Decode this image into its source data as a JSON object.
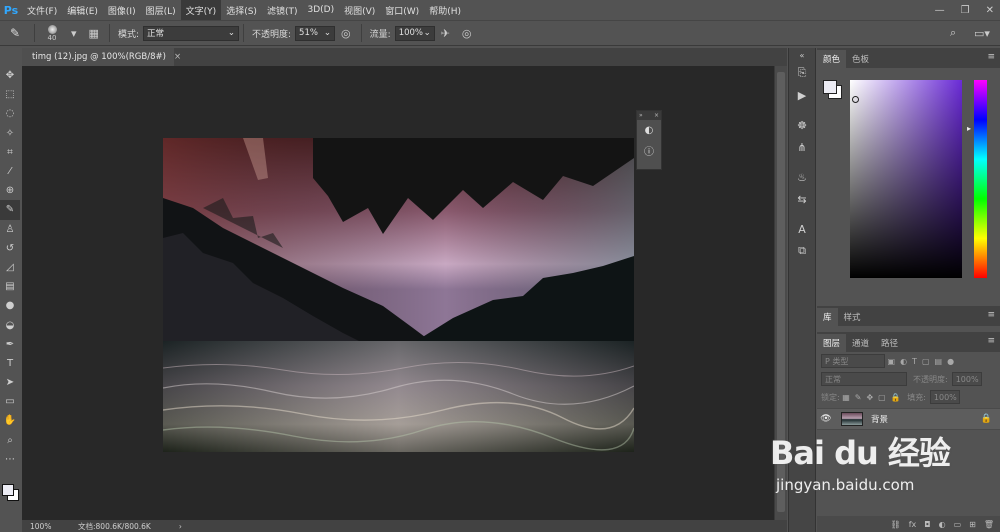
{
  "app": {
    "logo": "Ps"
  },
  "menu": [
    "文件(F)",
    "编辑(E)",
    "图像(I)",
    "图层(L)",
    "文字(Y)",
    "选择(S)",
    "滤镜(T)",
    "3D(D)",
    "视图(V)",
    "窗口(W)",
    "帮助(H)"
  ],
  "window_controls": [
    "—",
    "❐",
    "✕"
  ],
  "options": {
    "brush_size": "40",
    "mode_label": "模式:",
    "mode_value": "正常",
    "opacity_label": "不透明度:",
    "opacity_value": "51%",
    "flow_label": "流量:",
    "flow_value": "100%"
  },
  "document": {
    "tab_title": "timg (12).jpg @ 100%(RGB/8#)",
    "tab_close": "×",
    "zoom": "100%",
    "doc_info": "文档:800.6K/800.6K",
    "status_arrow": "›"
  },
  "panels": {
    "color_tabs": [
      "颜色",
      "色板"
    ],
    "library_tabs": [
      "库",
      "样式"
    ],
    "layer_tabs": [
      "图层",
      "通道",
      "路径"
    ],
    "layer_filter": "P 类型",
    "blend_mode": "正常",
    "opacity_label": "不透明度:",
    "opacity_value": "100%",
    "lock_label": "锁定:",
    "fill_label": "填充:",
    "fill_value": "100%",
    "layer_name": "背景",
    "menu_icon": "≡"
  },
  "colors": {
    "foreground": "#ececf4",
    "background": "#ffffff",
    "hue_selected": "#6a2bd6"
  },
  "watermark": {
    "logo": "Bai du 经验",
    "url": "jingyan.baidu.com"
  }
}
